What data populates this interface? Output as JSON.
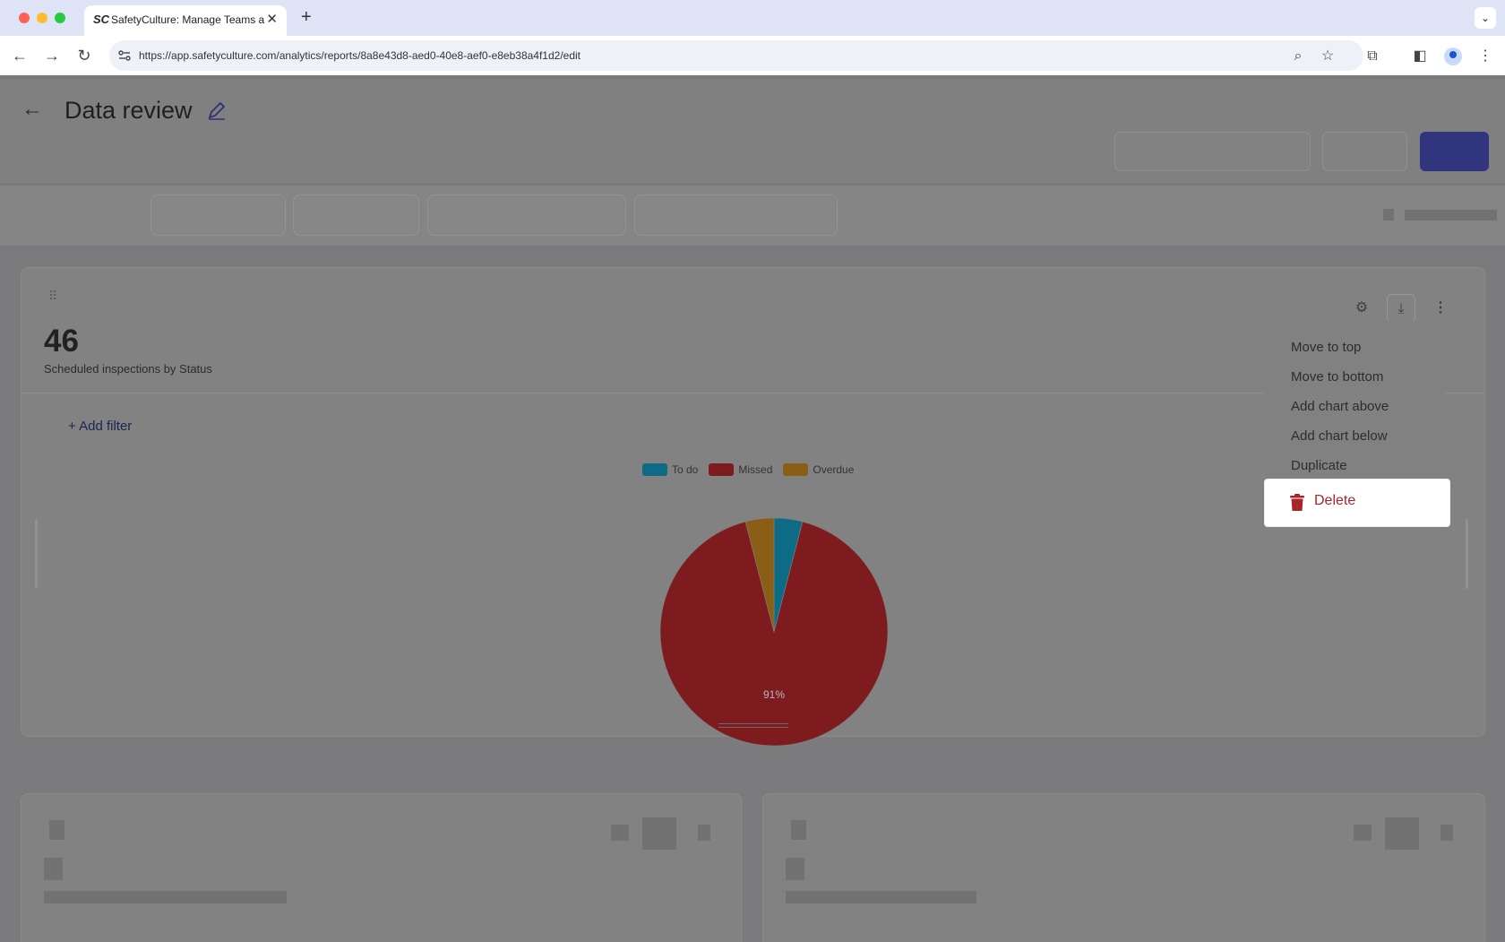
{
  "browser": {
    "tab_favicon": "SC",
    "tab_title": "SafetyCulture: Manage Teams and…",
    "url": "https://app.safetyculture.com/analytics/reports/8a8e43d8-aed0-40e8-aef0-e8eb38a4f1d2/edit"
  },
  "header": {
    "title": "Data review"
  },
  "card": {
    "count": "46",
    "subtitle": "Scheduled inspections by Status",
    "add_filter_label": "Add filter"
  },
  "menu": {
    "items": [
      "Move to top",
      "Move to bottom",
      "Add chart above",
      "Add chart below",
      "Duplicate"
    ],
    "delete_label": "Delete"
  },
  "chart_data": {
    "type": "pie",
    "categories": [
      "To do",
      "Missed",
      "Overdue"
    ],
    "values": [
      4,
      91,
      4
    ],
    "colors": [
      "#0e6b86",
      "#7e1b1f",
      "#8b5e15"
    ],
    "slice_labels": [
      "",
      "91%",
      ""
    ],
    "legend": "top"
  }
}
